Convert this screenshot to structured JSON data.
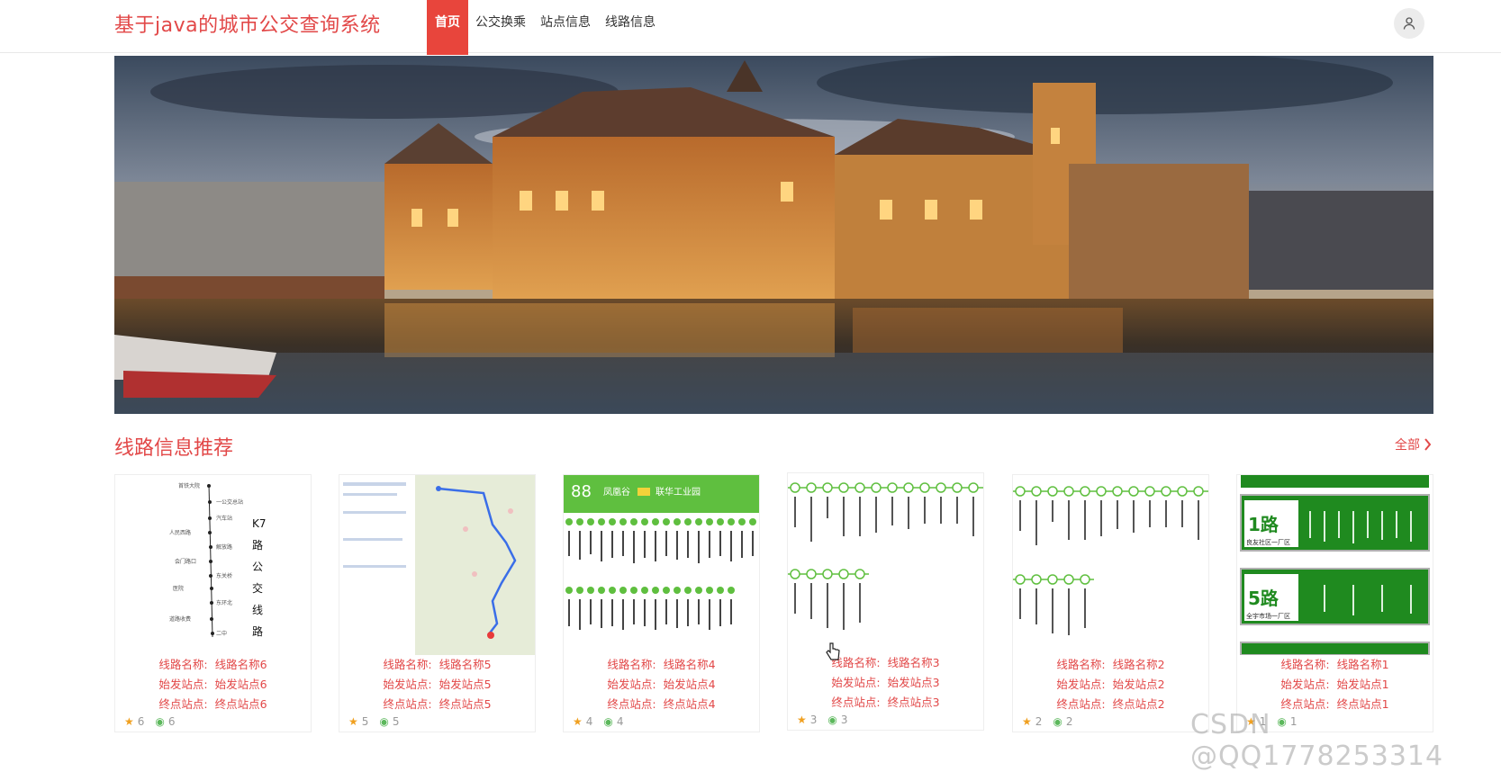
{
  "header": {
    "brand": "基于java的城市公交查询系统",
    "nav": [
      "首页",
      "公交换乘",
      "站点信息",
      "线路信息"
    ]
  },
  "section": {
    "title": "线路信息推荐",
    "more": "全部"
  },
  "labels": {
    "route_name": "线路名称:",
    "start_station": "始发站点:",
    "end_station": "终点站点:"
  },
  "cards": [
    {
      "name": "线路名称6",
      "start": "始发站点6",
      "end": "终点站点6",
      "stars": "6",
      "views": "6",
      "thumb_text": [
        "K7",
        "路",
        "公",
        "交",
        "线",
        "路"
      ]
    },
    {
      "name": "线路名称5",
      "start": "始发站点5",
      "end": "终点站点5",
      "stars": "5",
      "views": "5"
    },
    {
      "name": "线路名称4",
      "start": "始发站点4",
      "end": "终点站点4",
      "stars": "4",
      "views": "4",
      "thumb_text": [
        "88",
        "凤凰谷",
        "联华工业园"
      ]
    },
    {
      "name": "线路名称3",
      "start": "始发站点3",
      "end": "终点站点3",
      "stars": "3",
      "views": "3"
    },
    {
      "name": "线路名称2",
      "start": "始发站点2",
      "end": "终点站点2",
      "stars": "2",
      "views": "2"
    },
    {
      "name": "线路名称1",
      "start": "始发站点1",
      "end": "终点站点1",
      "stars": "1",
      "views": "1",
      "thumb_text": [
        "1路",
        "5路",
        "良友社区一厂区",
        "全宇市场一厂区"
      ]
    }
  ],
  "watermark": "CSDN @QQ1778253314",
  "colors": {
    "accent": "#e8453c",
    "text_red": "#e24848",
    "bus_green": "#1f8a1f"
  }
}
